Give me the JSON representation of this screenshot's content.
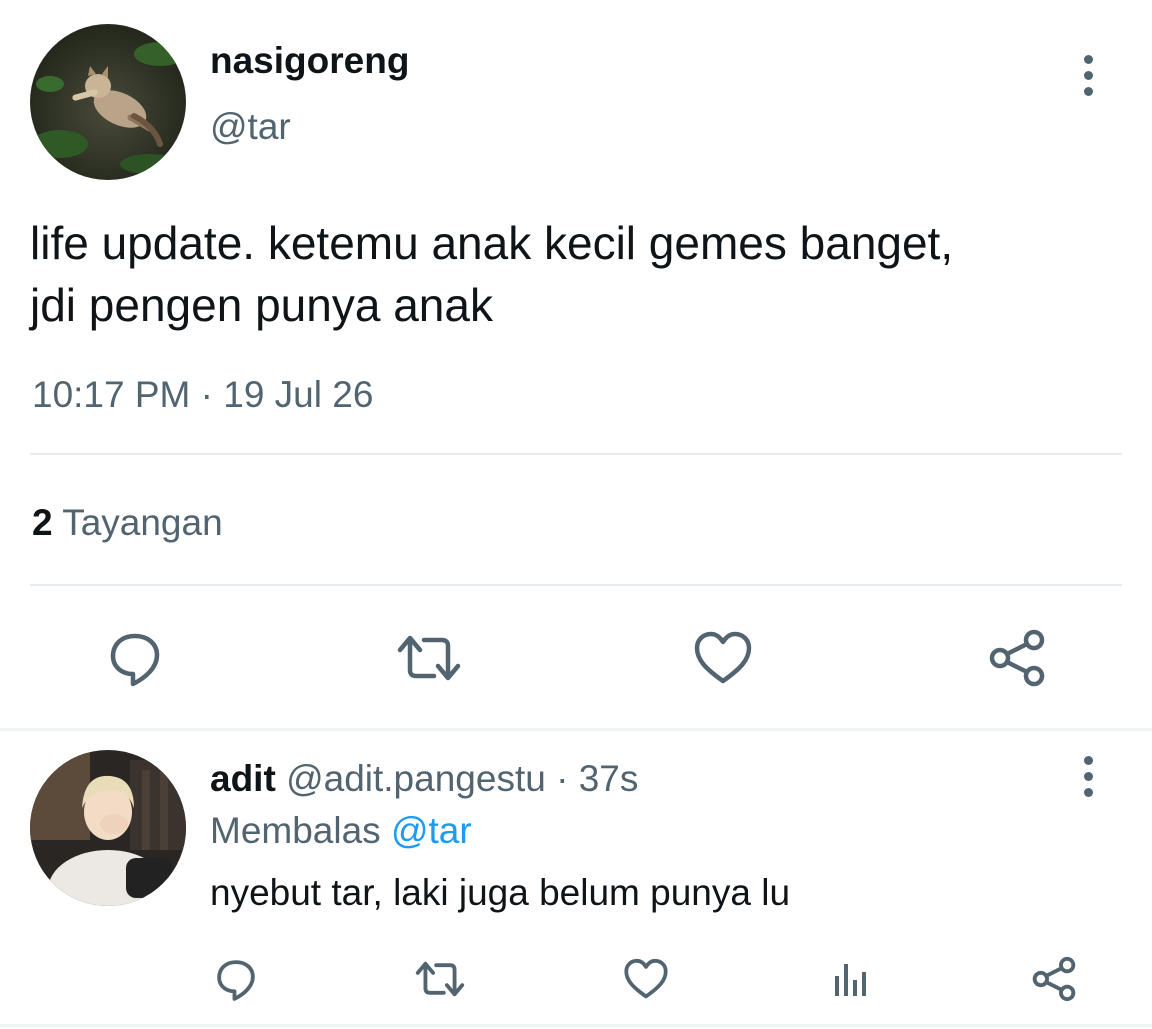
{
  "tweet": {
    "display_name": "nasigoreng",
    "handle": "@tar",
    "text_line1": "life update. ketemu anak kecil gemes banget,",
    "text_line2": "jdi pengen punya anak",
    "timestamp": "10:17 PM · 19 Jul 26",
    "views_count": "2",
    "views_label": "Tayangan",
    "actions": [
      "reply-icon",
      "retweet-icon",
      "like-icon",
      "share-icon"
    ]
  },
  "reply": {
    "display_name": "adit",
    "handle": "@adit.pangestu",
    "time": "· 37s",
    "replying_prefix": "Membalas",
    "replying_to": "@tar",
    "text": "nyebut tar, laki juga belum punya lu",
    "actions": [
      "reply-icon",
      "retweet-icon",
      "like-icon",
      "views-icon",
      "share-icon"
    ]
  },
  "colors": {
    "primary_text": "#0f1419",
    "secondary_text": "#536471",
    "accent": "#1d9bf0",
    "divider": "#e6ecf0"
  }
}
